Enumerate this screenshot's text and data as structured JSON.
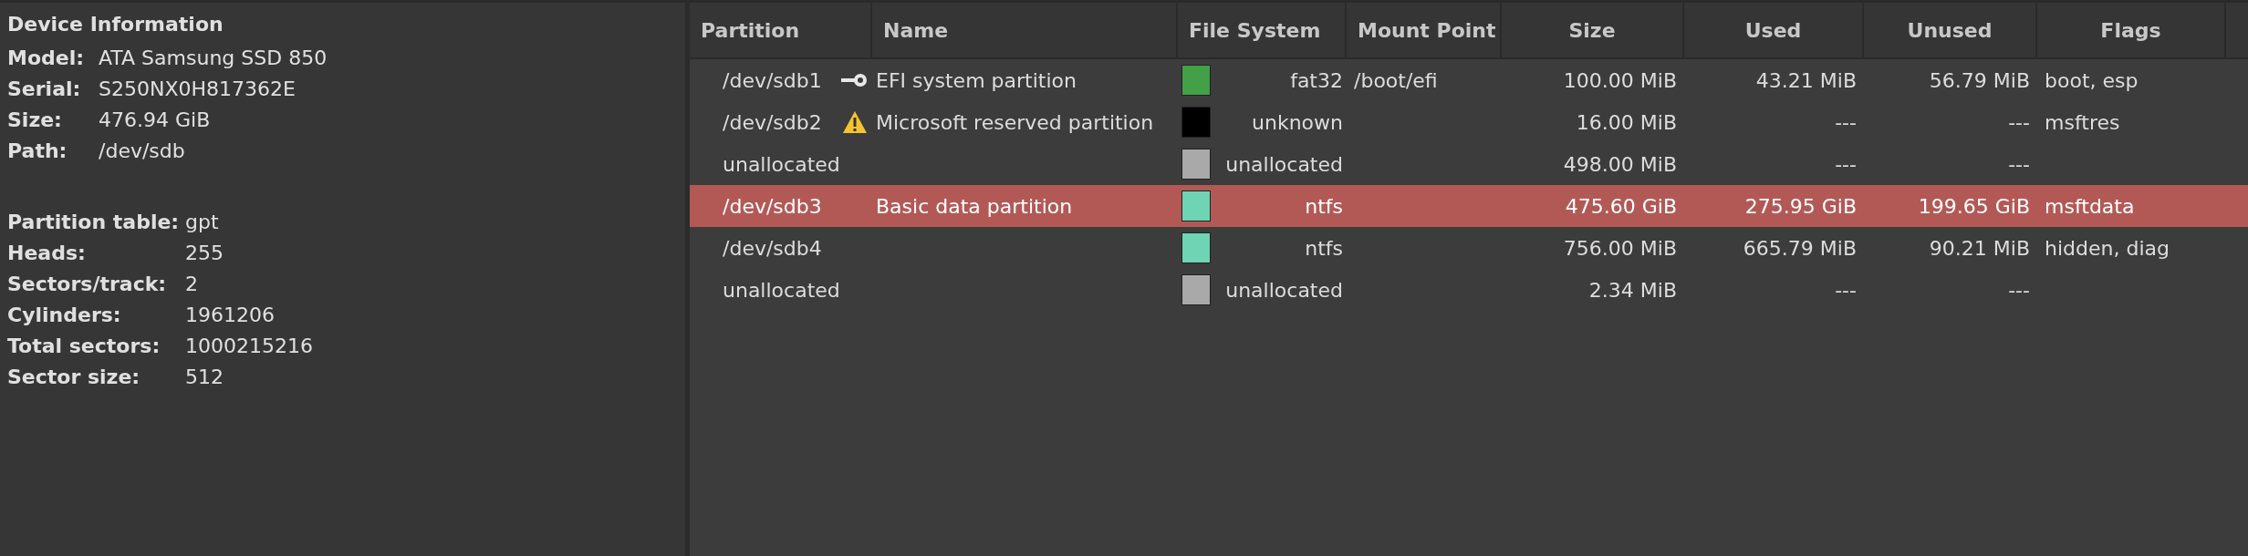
{
  "device_info": {
    "title": "Device Information",
    "groups": [
      [
        {
          "label": "Model:",
          "value": "ATA Samsung SSD 850"
        },
        {
          "label": "Serial:",
          "value": "S250NX0H817362E"
        },
        {
          "label": "Size:",
          "value": "476.94 GiB"
        },
        {
          "label": "Path:",
          "value": "/dev/sdb"
        }
      ],
      [
        {
          "label": "Partition table:",
          "value": "gpt"
        },
        {
          "label": "Heads:",
          "value": "255"
        },
        {
          "label": "Sectors/track:",
          "value": "2"
        },
        {
          "label": "Cylinders:",
          "value": "1961206"
        },
        {
          "label": "Total sectors:",
          "value": "1000215216"
        },
        {
          "label": "Sector size:",
          "value": "512"
        }
      ]
    ]
  },
  "table": {
    "columns": [
      "Partition",
      "Name",
      "File System",
      "Mount Point",
      "Size",
      "Used",
      "Unused",
      "Flags"
    ],
    "rows": [
      {
        "partition": "/dev/sdb1",
        "kind": "key",
        "name": "EFI system partition",
        "color": "#43a047",
        "file_system": "fat32",
        "mount_point": "/boot/efi",
        "size": "100.00 MiB",
        "used": "43.21 MiB",
        "unused": "56.79 MiB",
        "flags": "boot, esp",
        "selected": false
      },
      {
        "partition": "/dev/sdb2",
        "kind": "warning",
        "name": "Microsoft reserved partition",
        "color": "#000000",
        "file_system": "unknown",
        "mount_point": "",
        "size": "16.00 MiB",
        "used": "---",
        "unused": "---",
        "flags": "msftres",
        "selected": false
      },
      {
        "partition": "unallocated",
        "kind": "plain",
        "name": "",
        "color": "#a9a9a9",
        "file_system": "unallocated",
        "mount_point": "",
        "size": "498.00 MiB",
        "used": "---",
        "unused": "---",
        "flags": "",
        "selected": false
      },
      {
        "partition": "/dev/sdb3",
        "kind": "plain",
        "name": "Basic data partition",
        "color": "#6ed4b4",
        "file_system": "ntfs",
        "mount_point": "",
        "size": "475.60 GiB",
        "used": "275.95 GiB",
        "unused": "199.65 GiB",
        "flags": "msftdata",
        "selected": true
      },
      {
        "partition": "/dev/sdb4",
        "kind": "plain",
        "name": "",
        "color": "#6ed4b4",
        "file_system": "ntfs",
        "mount_point": "",
        "size": "756.00 MiB",
        "used": "665.79 MiB",
        "unused": "90.21 MiB",
        "flags": "hidden, diag",
        "selected": false
      },
      {
        "partition": "unallocated",
        "kind": "plain",
        "name": "",
        "color": "#a9a9a9",
        "file_system": "unallocated",
        "mount_point": "",
        "size": "2.34 MiB",
        "used": "---",
        "unused": "---",
        "flags": "",
        "selected": false
      }
    ]
  }
}
